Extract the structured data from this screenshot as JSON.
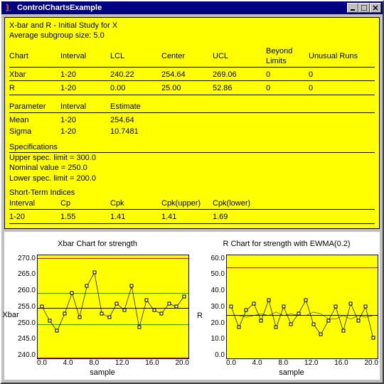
{
  "window": {
    "title": "ControlChartsExample"
  },
  "report": {
    "heading": "X-bar and R - Initial Study for X",
    "subgroup": "Average subgroup size: 5.0",
    "charts_table": {
      "headers": [
        "Chart",
        "Interval",
        "LCL",
        "Center",
        "UCL",
        "Beyond Limits",
        "Unusual Runs"
      ],
      "rows": [
        [
          "Xbar",
          "1-20",
          "240.22",
          "254.64",
          "269.06",
          "0",
          "0"
        ],
        [
          "R",
          "1-20",
          "0.00",
          "25.00",
          "52.86",
          "0",
          "0"
        ]
      ]
    },
    "param_table": {
      "headers": [
        "Parameter",
        "Interval",
        "Estimate"
      ],
      "rows": [
        [
          "Mean",
          "1-20",
          "254.64"
        ],
        [
          "Sigma",
          "1-20",
          "10.7481"
        ]
      ]
    },
    "specs": {
      "title": "Specifications",
      "upper": "Upper spec. limit = 300.0",
      "nominal": "Nominal value = 250.0",
      "lower": "Lower spec. limit = 200.0"
    },
    "indices": {
      "title": "Short-Term Indices",
      "headers": [
        "Interval",
        "Cp",
        "Cpk",
        "Cpk(upper)",
        "Cpk(lower)"
      ],
      "rows": [
        [
          "1-20",
          "1.55",
          "1.41",
          "1.41",
          "1.69"
        ]
      ]
    }
  },
  "chart_data": [
    {
      "type": "line",
      "title": "Xbar Chart for strength",
      "ylabel": "Xbar",
      "xlabel": "sample",
      "ylim": [
        240,
        270
      ],
      "yticks": [
        "270.0",
        "265.0",
        "260.0",
        "255.0",
        "250.0",
        "245.0",
        "240.0"
      ],
      "xticks": [
        "0.0",
        "4.0",
        "8.0",
        "12.0",
        "16.0",
        "20.0"
      ],
      "center": 254.64,
      "ucl": 269.06,
      "lcl": 240.22,
      "sigma_lines": [
        250,
        259
      ],
      "x": [
        1,
        2,
        3,
        4,
        5,
        6,
        7,
        8,
        9,
        10,
        11,
        12,
        13,
        14,
        15,
        16,
        17,
        18,
        19,
        20
      ],
      "values": [
        255,
        251,
        248,
        253,
        259,
        252,
        261,
        265,
        253,
        252,
        256,
        254,
        261,
        249,
        257,
        254,
        253,
        256,
        255,
        258
      ]
    },
    {
      "type": "line",
      "title": "R Chart for strength with EWMA(0.2)",
      "ylabel": "R",
      "xlabel": "sample",
      "ylim": [
        0,
        60
      ],
      "yticks": [
        "60.0",
        "50.0",
        "40.0",
        "30.0",
        "20.0",
        "10.0",
        "0.0"
      ],
      "xticks": [
        "0.0",
        "4.0",
        "8.0",
        "12.0",
        "16.0",
        "20.0"
      ],
      "center": 25.0,
      "ucl": 52.86,
      "lcl": 0.0,
      "x": [
        1,
        2,
        3,
        4,
        5,
        6,
        7,
        8,
        9,
        10,
        11,
        12,
        13,
        14,
        15,
        16,
        17,
        18,
        19,
        20
      ],
      "values": [
        30,
        18,
        28,
        32,
        22,
        34,
        18,
        30,
        20,
        26,
        34,
        20,
        14,
        22,
        30,
        16,
        32,
        22,
        30,
        12
      ],
      "ewma": [
        25,
        25,
        24,
        25,
        26,
        25,
        27,
        25,
        26,
        25,
        25,
        27,
        26,
        23,
        23,
        25,
        23,
        25,
        24,
        25
      ]
    }
  ]
}
